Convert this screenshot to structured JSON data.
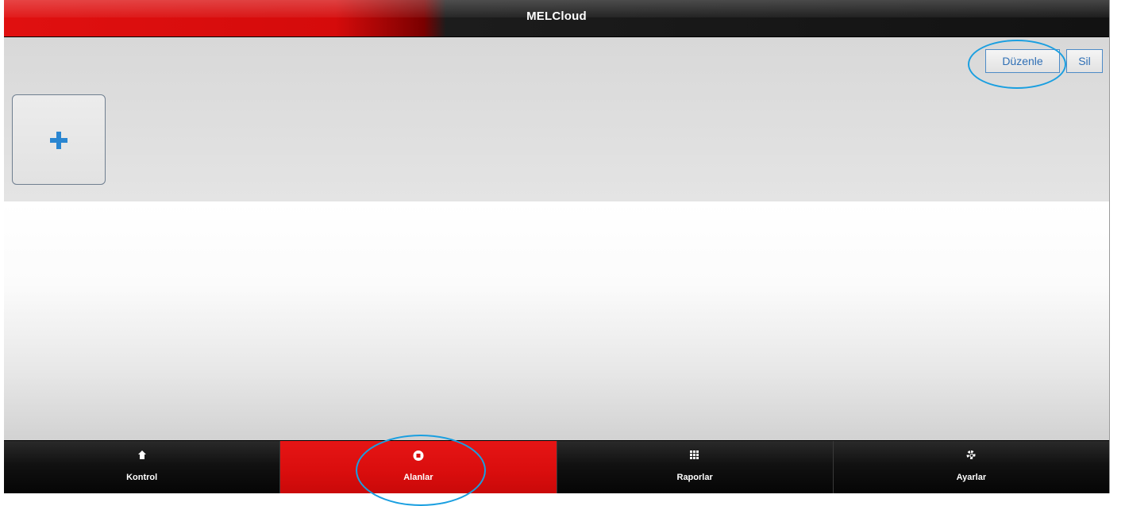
{
  "header": {
    "title": "MELCloud"
  },
  "toolbar": {
    "edit_label": "Düzenle",
    "delete_label": "Sil"
  },
  "content": {
    "add_tile_icon": "plus-icon"
  },
  "tabs": [
    {
      "label": "Kontrol",
      "icon": "home-icon",
      "active": false
    },
    {
      "label": "Alanlar",
      "icon": "areas-icon",
      "active": true
    },
    {
      "label": "Raporlar",
      "icon": "grid-icon",
      "active": false
    },
    {
      "label": "Ayarlar",
      "icon": "gear-icon",
      "active": false
    }
  ],
  "colors": {
    "brand_red": "#e01010",
    "header_dark": "#121212",
    "button_blue": "#2f6fb5",
    "plus_blue": "#2a86d1",
    "annotation_blue": "#1a9fe0"
  }
}
